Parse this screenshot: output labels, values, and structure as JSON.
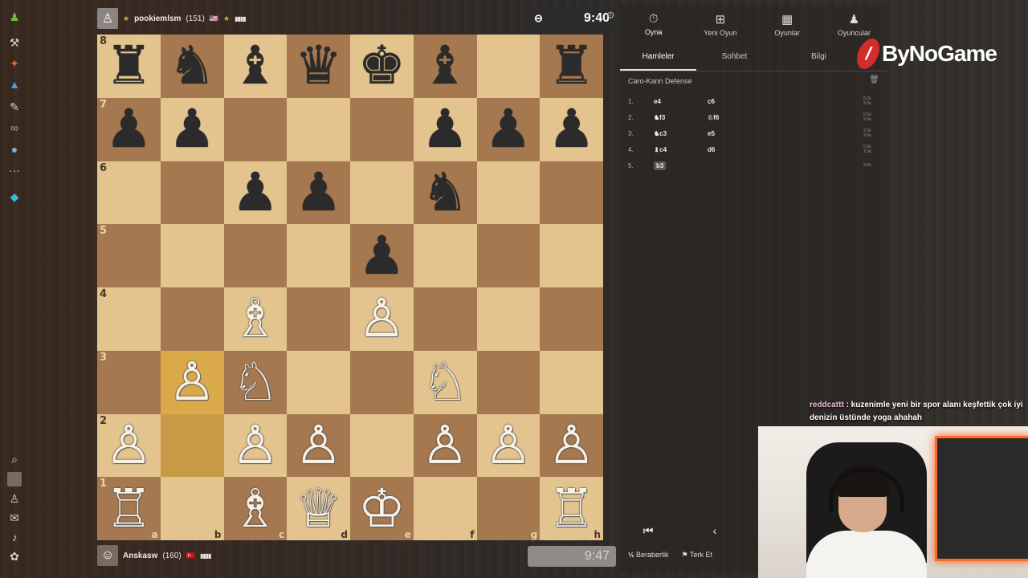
{
  "sidebar": {
    "icons": [
      "pawn-icon",
      "hammer-icon",
      "puzzle-icon",
      "learn-icon",
      "tools-icon",
      "binoculars-icon",
      "social-icon",
      "more-icon",
      "diamond-icon",
      "search-icon",
      "user-icon",
      "friends-icon",
      "mail-icon",
      "bell-icon",
      "settings-icon"
    ]
  },
  "top_player": {
    "name": "pookiemlsm",
    "rating": "(151)",
    "clock": "9:40"
  },
  "bottom_player": {
    "name": "Anskasw",
    "rating": "(160)",
    "clock": "9:47"
  },
  "board": {
    "ranks": [
      "8",
      "7",
      "6",
      "5",
      "4",
      "3",
      "2",
      "1"
    ],
    "files": [
      "a",
      "b",
      "c",
      "d",
      "e",
      "f",
      "g",
      "h"
    ],
    "position": [
      [
        "♜",
        "♞",
        "♝",
        "♛",
        "♚",
        "♝",
        "",
        "♜"
      ],
      [
        "♟",
        "♟",
        "",
        "",
        "",
        "♟",
        "♟",
        "♟"
      ],
      [
        "",
        "",
        "♟",
        "♟",
        "",
        "♞",
        "",
        ""
      ],
      [
        "",
        "",
        "",
        "",
        "♟",
        "",
        "",
        ""
      ],
      [
        "",
        "",
        "♗",
        "",
        "♙",
        "",
        "",
        ""
      ],
      [
        "",
        "♙",
        "♘",
        "",
        "",
        "♘",
        "",
        ""
      ],
      [
        "♙",
        "",
        "♙",
        "♙",
        "",
        "♙",
        "♙",
        "♙"
      ],
      [
        "♖",
        "",
        "♗",
        "♕",
        "♔",
        "",
        "",
        "♖"
      ]
    ],
    "white_pieces": [
      "♔",
      "♕",
      "♖",
      "♗",
      "♘",
      "♙"
    ],
    "last_move": {
      "from": "b2",
      "to": "b3"
    }
  },
  "panel": {
    "nav": [
      {
        "label": "Oyna",
        "icon": "stopwatch-icon"
      },
      {
        "label": "Yeni Oyun",
        "icon": "plus-icon"
      },
      {
        "label": "Oyunlar",
        "icon": "board-icon"
      },
      {
        "label": "Oyuncular",
        "icon": "players-icon"
      }
    ],
    "tabs": [
      "Hamleler",
      "Sohbet",
      "Bilgi"
    ],
    "opening": "Caro-Kann Defense",
    "moves": [
      {
        "num": "1.",
        "white": "e4",
        "black": "c6",
        "times": [
          "6.2s",
          "3.9s"
        ]
      },
      {
        "num": "2.",
        "white": "♞f3",
        "black": "♘f6",
        "times": [
          "0.5s",
          "2.3s"
        ]
      },
      {
        "num": "3.",
        "white": "♞c3",
        "black": "e5",
        "times": [
          "2.0s",
          "2.6s"
        ]
      },
      {
        "num": "4.",
        "white": "♝c4",
        "black": "d6",
        "times": [
          "0.9s",
          "1.5s"
        ]
      },
      {
        "num": "5.",
        "white": "b3",
        "black": "",
        "times": [
          "2.8s",
          ""
        ]
      }
    ],
    "draw_label": "Beraberlik",
    "resign_label": "Terk Et"
  },
  "logo": "ByNoGame",
  "chat": {
    "user": "reddcattt",
    "message": " : kuzenimle yeni bir spor alanı keşfettik çok iyi denizin üstünde yoga ahahah"
  }
}
